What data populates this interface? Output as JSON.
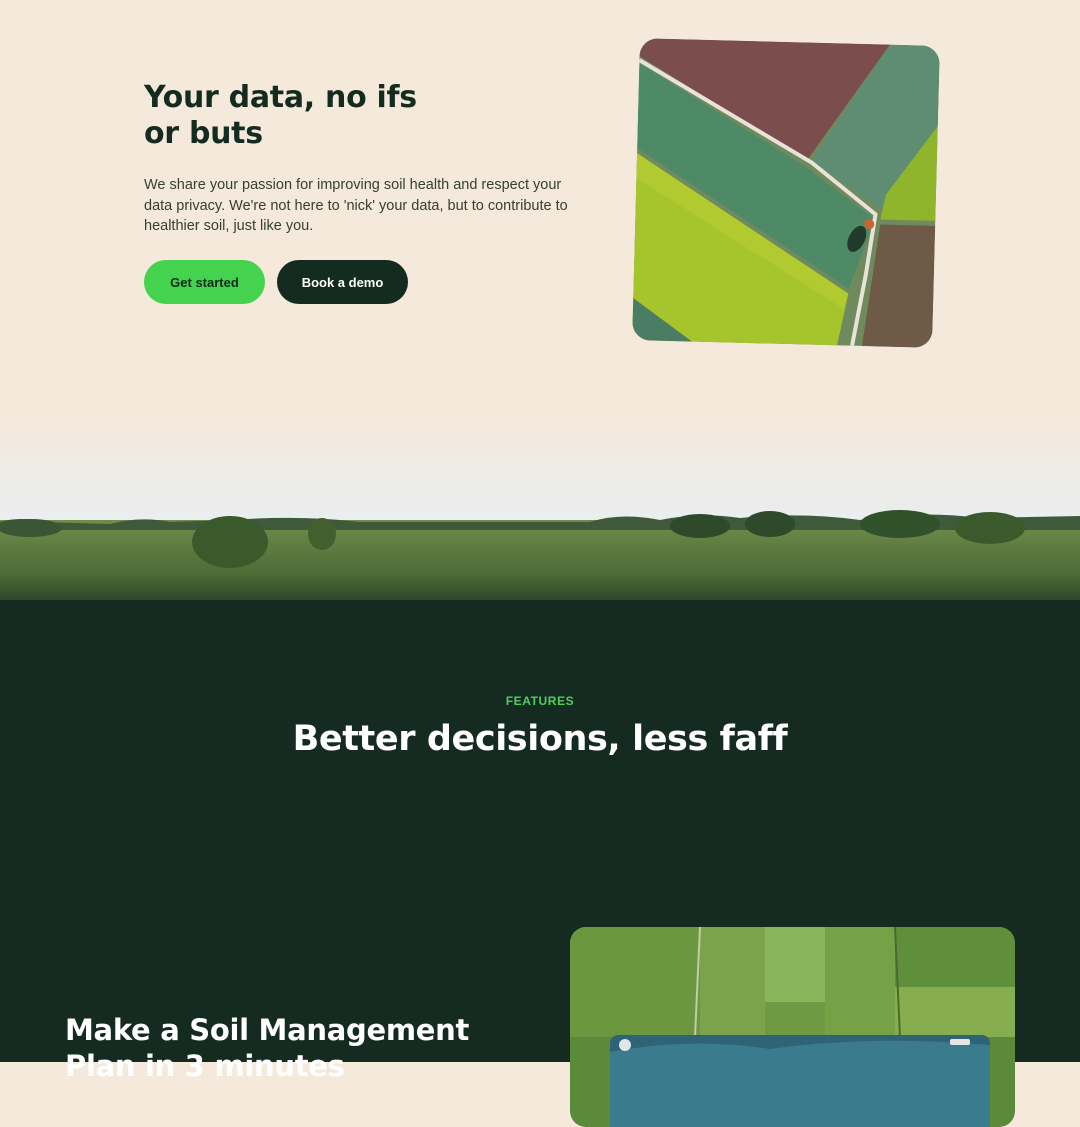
{
  "hero": {
    "title": "Your data, no ifs or buts",
    "body": "We share your passion for improving soil health and respect your data privacy. We're not here to 'nick' your data, but to contribute to healthier soil, just like you.",
    "primary_button": "Get started",
    "secondary_button": "Book a demo"
  },
  "features": {
    "eyebrow": "FEATURES",
    "title": "Better decisions, less faff",
    "plan_title": "Make a Soil Management Plan in 3 minutes"
  },
  "colors": {
    "background": "#f4e9db",
    "dark": "#142b20",
    "accent": "#45d34f"
  }
}
